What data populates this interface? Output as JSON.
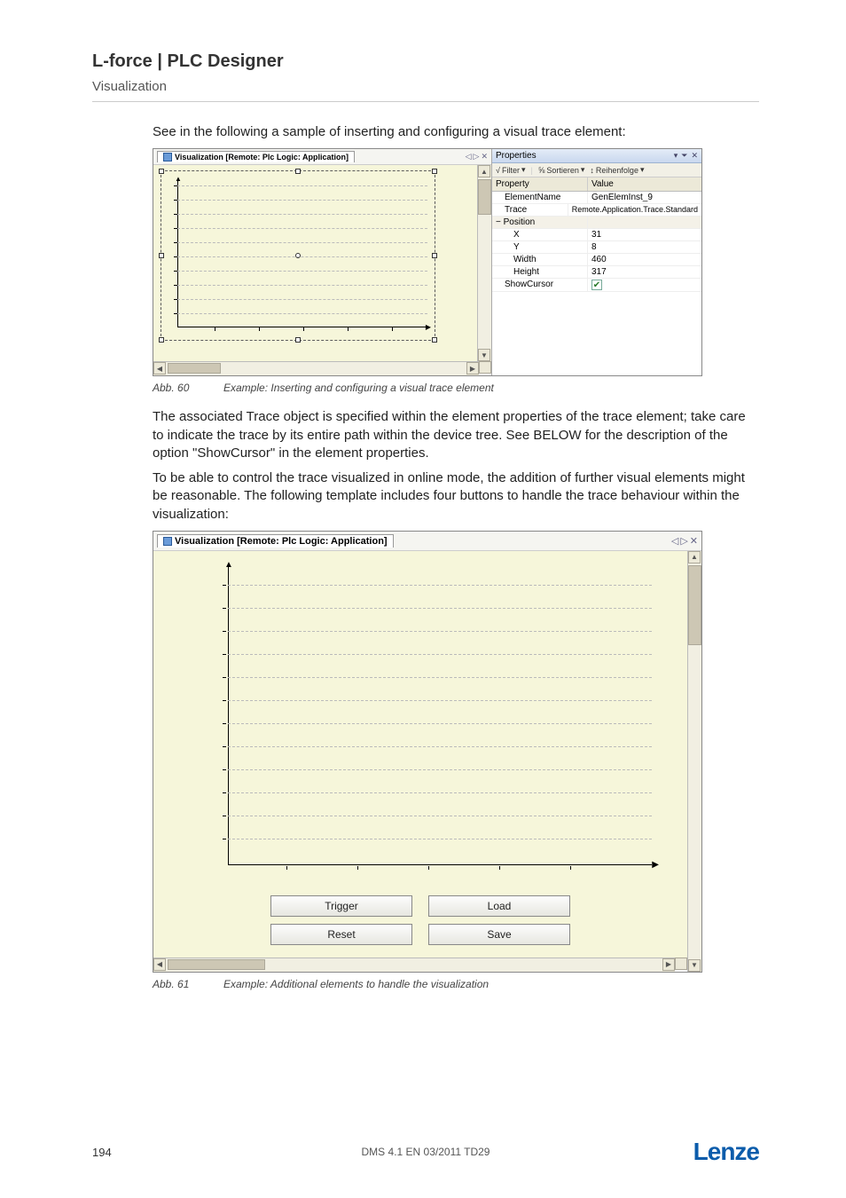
{
  "header": {
    "title": "L-force | PLC Designer",
    "subtitle": "Visualization"
  },
  "intro": "See in the following a sample of inserting and configuring a visual trace element:",
  "fig60": {
    "tab_title": "Visualization [Remote: Plc Logic: Application]",
    "tab_nav_prev": "◁",
    "tab_nav_next": "▷",
    "tab_close": "✕",
    "properties": {
      "title": "Properties",
      "toolbar": {
        "filter": "Filter",
        "sort": "Sortieren",
        "order": "Reihenfolge"
      },
      "col_property": "Property",
      "col_value": "Value",
      "rows": {
        "elementname_label": "ElementName",
        "elementname_value": "GenElemInst_9",
        "trace_label": "Trace",
        "trace_value": "Remote.Application.Trace.Standard",
        "position_label": "Position",
        "x_label": "X",
        "x_value": "31",
        "y_label": "Y",
        "y_value": "8",
        "width_label": "Width",
        "width_value": "460",
        "height_label": "Height",
        "height_value": "317",
        "showcursor_label": "ShowCursor"
      }
    },
    "caption_abb": "Abb. 60",
    "caption_text": "Example: Inserting and configuring a visual trace element"
  },
  "para1": "The associated Trace object is specified within the element properties of the trace element; take care to indicate the trace by its entire path within the device tree. See BELOW for the description of the option \"ShowCursor\" in the element properties.",
  "para2": "To be able to control the trace visualized in online mode, the addition of further visual elements might be reasonable. The following template includes four buttons to handle the trace behaviour within the visualization:",
  "fig61": {
    "tab_title": "Visualization [Remote: Plc Logic: Application]",
    "buttons": {
      "trigger": "Trigger",
      "load": "Load",
      "reset": "Reset",
      "save": "Save"
    },
    "caption_abb": "Abb. 61",
    "caption_text": "Example: Additional elements to handle the visualization"
  },
  "footer": {
    "page": "194",
    "doc": "DMS 4.1 EN 03/2011 TD29",
    "brand": "Lenze"
  },
  "glyphs": {
    "dropdown": "▾",
    "check": "✔",
    "left": "◀",
    "right": "▶",
    "up": "▲",
    "down": "▼",
    "minus": "−"
  }
}
